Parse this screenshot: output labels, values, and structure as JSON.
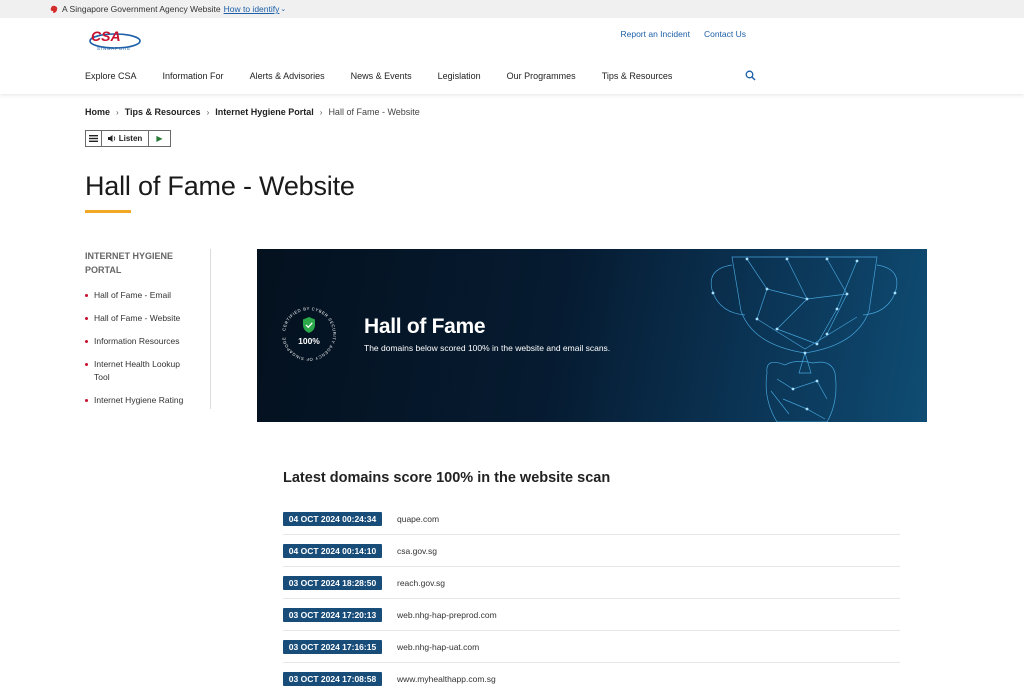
{
  "masthead": {
    "text": "A Singapore Government Agency Website",
    "identify_link": "How to identify"
  },
  "header": {
    "logo_text": "CSA",
    "logo_subtext": "SINGAPORE",
    "top_links": [
      "Report an Incident",
      "Contact Us"
    ],
    "nav": [
      "Explore CSA",
      "Information For",
      "Alerts & Advisories",
      "News & Events",
      "Legislation",
      "Our Programmes",
      "Tips & Resources"
    ]
  },
  "breadcrumb": [
    "Home",
    "Tips & Resources",
    "Internet Hygiene Portal",
    "Hall of Fame - Website"
  ],
  "listen": {
    "label": "Listen"
  },
  "page_title": "Hall of Fame - Website",
  "sidebar": {
    "heading": "INTERNET HYGIENE PORTAL",
    "items": [
      "Hall of Fame - Email",
      "Hall of Fame - Website",
      "Information Resources",
      "Internet Health Lookup Tool",
      "Internet Hygiene Rating"
    ]
  },
  "banner": {
    "badge_ring_text": "CERTIFIED BY CYBER SECURITY AGENCY OF SINGAPORE",
    "badge_value": "100%",
    "title": "Hall of Fame",
    "subtitle": "The domains below scored 100% in the website and email scans."
  },
  "latest": {
    "heading": "Latest domains score 100% in the website scan",
    "rows": [
      {
        "date": "04 OCT 2024 00:24:34",
        "domain": "quape.com"
      },
      {
        "date": "04 OCT 2024 00:14:10",
        "domain": "csa.gov.sg"
      },
      {
        "date": "03 OCT 2024 18:28:50",
        "domain": "reach.gov.sg"
      },
      {
        "date": "03 OCT 2024 17:20:13",
        "domain": "web.nhg-hap-preprod.com"
      },
      {
        "date": "03 OCT 2024 17:16:15",
        "domain": "web.nhg-hap-uat.com"
      },
      {
        "date": "03 OCT 2024 17:08:58",
        "domain": "www.myhealthapp.com.sg"
      }
    ]
  },
  "colors": {
    "accent_link": "#1d5fa8",
    "title_underline": "#f0a926",
    "date_badge": "#184c79",
    "bullet": "#c8102e"
  }
}
